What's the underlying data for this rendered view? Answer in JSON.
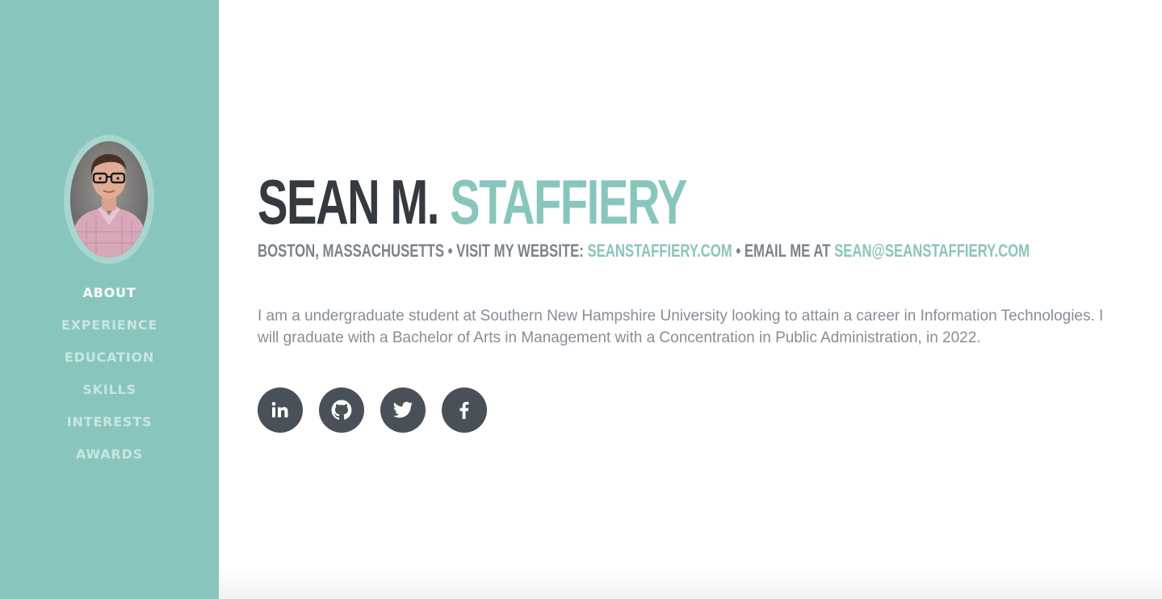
{
  "colors": {
    "sidebar_bg": "#88c6bd",
    "accent": "#88c6bd",
    "heading_dark": "#343a40",
    "subheading": "#7c838a",
    "body_text": "#868e96",
    "social_bg": "#495057"
  },
  "nav": {
    "items": [
      {
        "label": "ABOUT",
        "active": true
      },
      {
        "label": "EXPERIENCE",
        "active": false
      },
      {
        "label": "EDUCATION",
        "active": false
      },
      {
        "label": "SKILLS",
        "active": false
      },
      {
        "label": "INTERESTS",
        "active": false
      },
      {
        "label": "AWARDS",
        "active": false
      }
    ]
  },
  "about": {
    "first_name": "SEAN M.",
    "last_name": "STAFFIERY",
    "location": "BOSTON, MASSACHUSETTS",
    "separator": "•",
    "website_prefix": "VISIT MY WEBSITE:",
    "website": "SEANSTAFFIERY.COM",
    "email_prefix": "EMAIL ME AT",
    "email": "SEAN@SEANSTAFFIERY.COM",
    "bio": "I am a undergraduate student at Southern New Hampshire University looking to attain a career in Information Technologies. I will graduate with a Bachelor of Arts in Management with a Concentration in Public Administration, in 2022."
  },
  "social": [
    {
      "icon": "linkedin-icon"
    },
    {
      "icon": "github-icon"
    },
    {
      "icon": "twitter-icon"
    },
    {
      "icon": "facebook-icon"
    }
  ]
}
